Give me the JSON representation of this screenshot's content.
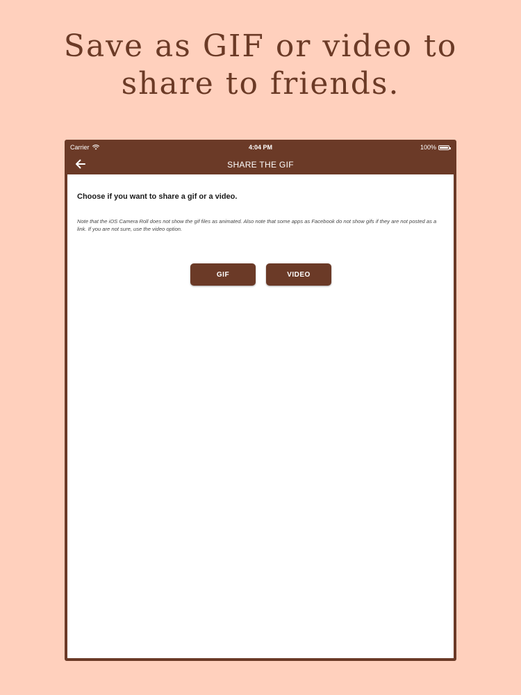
{
  "headline": {
    "line1": "Save as GIF or video to",
    "line2": "share to friends."
  },
  "status_bar": {
    "carrier": "Carrier",
    "time": "4:04 PM",
    "battery": "100%",
    "icons": [
      "wifi-icon",
      "battery-icon"
    ]
  },
  "nav": {
    "title": "SHARE THE GIF",
    "back_icon": "arrow-left-icon"
  },
  "content": {
    "prompt": "Choose if you want to share a gif or a video.",
    "note": "Note that the iOS Camera Roll does not show the gif files as animated. Also note that some apps as Facebook do not show gifs if they are not posted as a link. If you are not sure, use the video option.",
    "gif_label": "GIF",
    "video_label": "VIDEO"
  },
  "colors": {
    "background": "#ffd0bd",
    "brand_brown": "#6b3a27",
    "headline_text": "#6b3a26"
  }
}
